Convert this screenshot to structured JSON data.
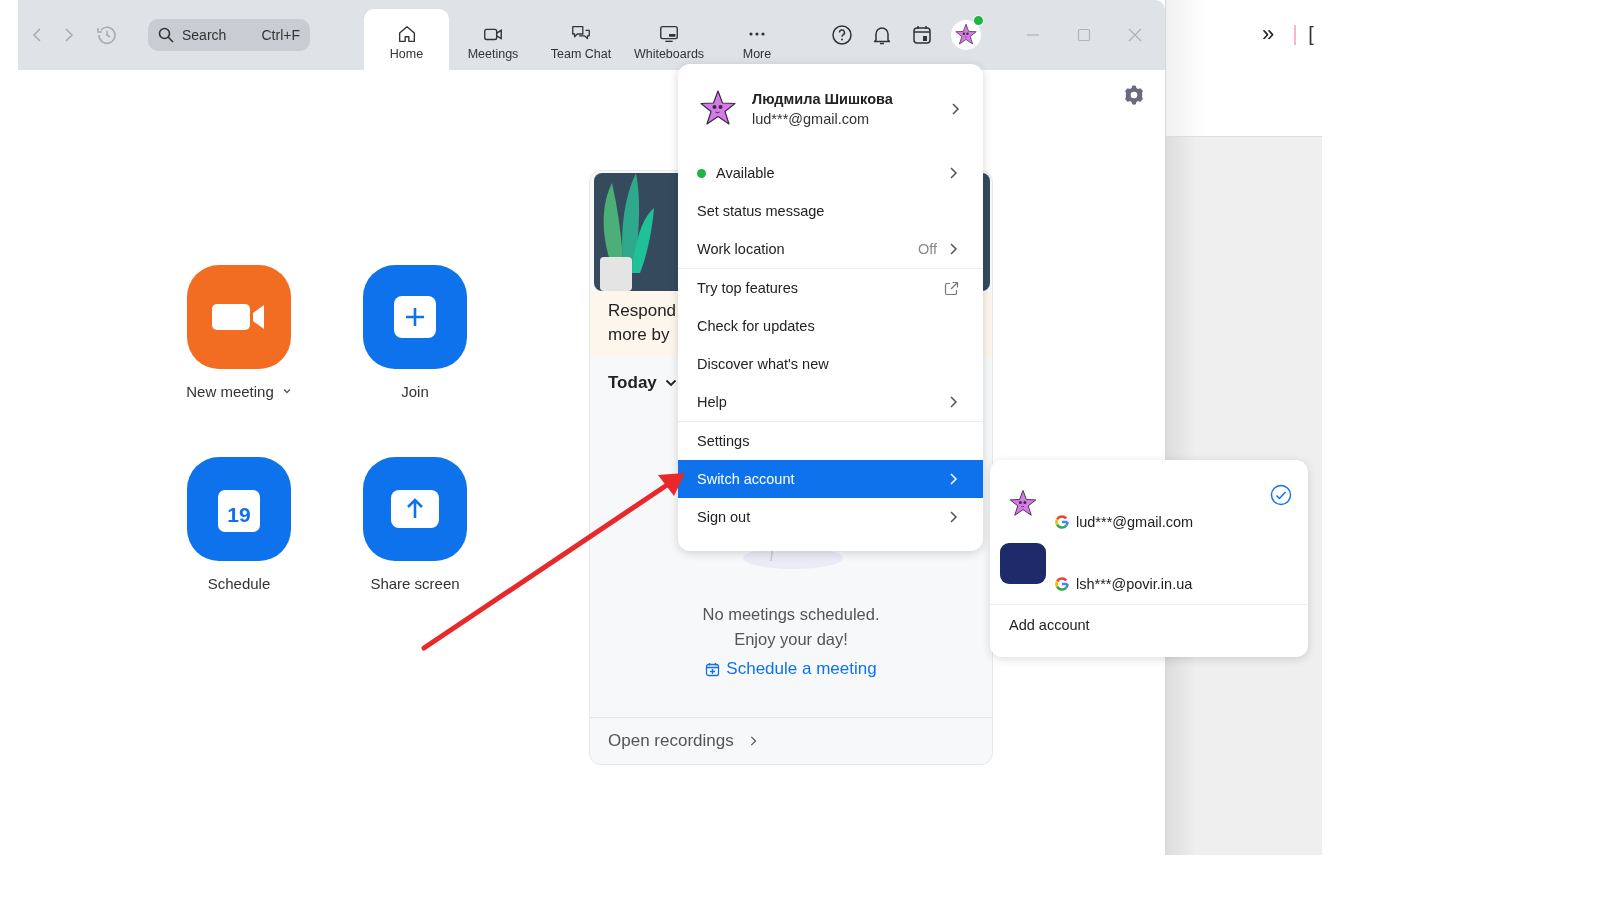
{
  "search": {
    "placeholder": "Search",
    "shortcut": "Ctrl+F"
  },
  "tabs": [
    {
      "label": "Home",
      "selected": true
    },
    {
      "label": "Meetings",
      "selected": false
    },
    {
      "label": "Team Chat",
      "selected": false
    },
    {
      "label": "Whiteboards",
      "selected": false
    },
    {
      "label": "More",
      "selected": false
    }
  ],
  "actions": [
    {
      "label": "New meeting",
      "kind": "video",
      "dropdown": true
    },
    {
      "label": "Join",
      "kind": "join",
      "dropdown": false
    },
    {
      "label": "Schedule",
      "kind": "schedule",
      "dropdown": false,
      "day": "19"
    },
    {
      "label": "Share screen",
      "kind": "share",
      "dropdown": false
    }
  ],
  "card": {
    "banner_lines": [
      "Respond",
      "more by"
    ],
    "day_filter": "Today",
    "empty_lines": [
      "No meetings scheduled.",
      "Enjoy your day!"
    ],
    "schedule_link": "Schedule a meeting",
    "footer": "Open recordings"
  },
  "profile_menu": {
    "name": "Людмила Шишкова",
    "email": "lud***@gmail.com",
    "sections": [
      [
        {
          "label": "Available",
          "kind": "status",
          "submenu": true,
          "external": false,
          "selected": false
        },
        {
          "label": "Set status message",
          "kind": "plain",
          "submenu": false,
          "external": false,
          "selected": false
        },
        {
          "label": "Work location",
          "kind": "plain",
          "value": "Off",
          "submenu": true,
          "external": false,
          "selected": false
        }
      ],
      [
        {
          "label": "Try top features",
          "kind": "plain",
          "submenu": false,
          "external": true,
          "selected": false
        },
        {
          "label": "Check for updates",
          "kind": "plain",
          "submenu": false,
          "external": false,
          "selected": false
        },
        {
          "label": "Discover what's new",
          "kind": "plain",
          "submenu": false,
          "external": false,
          "selected": false
        },
        {
          "label": "Help",
          "kind": "plain",
          "submenu": true,
          "external": false,
          "selected": false
        }
      ],
      [
        {
          "label": "Settings",
          "kind": "plain",
          "submenu": false,
          "external": false,
          "selected": false
        },
        {
          "label": "Switch account",
          "kind": "plain",
          "submenu": true,
          "external": false,
          "selected": true
        },
        {
          "label": "Sign out",
          "kind": "plain",
          "submenu": true,
          "external": false,
          "selected": false
        }
      ]
    ]
  },
  "switch_menu": {
    "accounts": [
      {
        "email": "lud***@gmail.com",
        "kind": "star",
        "checked": true
      },
      {
        "email": "lsh***@povir.in.ua",
        "kind": "block",
        "checked": false
      }
    ],
    "add_label": "Add account"
  },
  "side_strip": {
    "chevron": "»",
    "bracket": "["
  }
}
